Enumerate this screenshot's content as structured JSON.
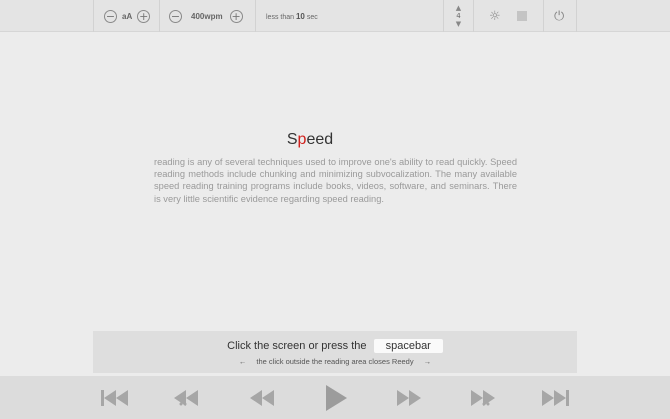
{
  "toolbar": {
    "font_size_label": "aA",
    "minus_symbol": "−",
    "plus_symbol": "+",
    "wpm_label": "400wpm",
    "time_prefix": "less than ",
    "time_value": "10",
    "time_suffix": " sec",
    "chunk_up": "▲",
    "chunk_value": "4",
    "chunk_down": "▼",
    "sun_icon": "☼",
    "power_icon": "⏻"
  },
  "reader": {
    "word_before": "S",
    "word_focus": "p",
    "word_after": "eed",
    "passage": "reading is any of several techniques used to improve one's ability to read quickly. Speed reading methods include chunking and minimizing subvocalization. The many available speed reading training programs include books, videos, software, and seminars. There is very little scientific evidence regarding speed reading."
  },
  "hint": {
    "main": "Click the screen or press the ",
    "key": "spacebar",
    "left_arrow": "←",
    "sub": "the click outside the reading area closes Reedy",
    "right_arrow": "→"
  },
  "controls": {
    "color": "#a6a6a6",
    "play_color": "#9c9c9c"
  }
}
